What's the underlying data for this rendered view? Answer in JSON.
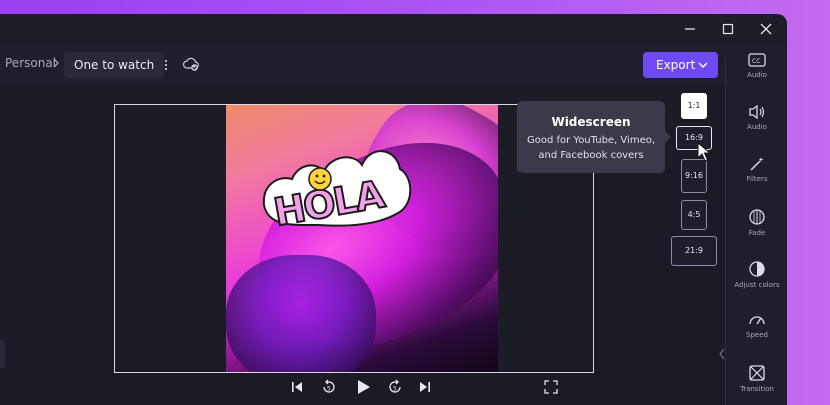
{
  "breadcrumb": {
    "parent": "Personal",
    "current": "One to watch"
  },
  "toolbar": {
    "export_label": "Export"
  },
  "colors": {
    "accent": "#6e4af4",
    "background": "#1f1f2b",
    "tooltip_bg": "#3a3a48"
  },
  "sticker_text": "HOLA",
  "aspect_ratios": [
    {
      "label": "1:1",
      "selected": true
    },
    {
      "label": "16:9",
      "selected": false
    },
    {
      "label": "9:16",
      "selected": false
    },
    {
      "label": "4:5",
      "selected": false
    },
    {
      "label": "21:9",
      "selected": false
    }
  ],
  "tooltip": {
    "title": "Widescreen",
    "body_line1": "Good for YouTube, Vimeo,",
    "body_line2": "and Facebook covers"
  },
  "right_panel": [
    {
      "label": "Audio",
      "icon": "captions-icon"
    },
    {
      "label": "Audio",
      "icon": "speaker-icon"
    },
    {
      "label": "Filters",
      "icon": "magic-wand-icon"
    },
    {
      "label": "Fade",
      "icon": "fade-icon"
    },
    {
      "label": "Adjust colors",
      "icon": "contrast-icon"
    },
    {
      "label": "Speed",
      "icon": "speedometer-icon"
    },
    {
      "label": "Transition",
      "icon": "transition-icon"
    }
  ],
  "playback": [
    "skip-back-icon",
    "rewind-5-icon",
    "play-icon",
    "forward-5-icon",
    "skip-forward-icon",
    "fullscreen-icon"
  ]
}
